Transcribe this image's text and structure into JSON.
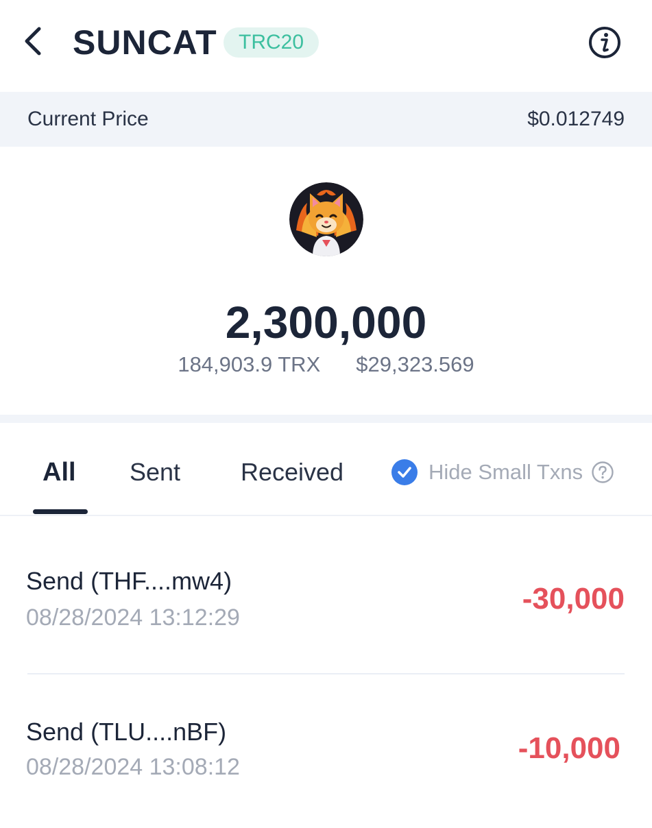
{
  "header": {
    "title": "SUNCAT",
    "badge": "TRC20",
    "back_icon": "chevron-left-icon",
    "info_icon": "info-circle-icon"
  },
  "price": {
    "label": "Current Price",
    "value": "$0.012749"
  },
  "token": {
    "logo_icon": "suncat-cat-logo",
    "balance": "2,300,000",
    "trx_amount": "184,903.9",
    "trx_unit": "TRX",
    "usd_value": "$29,323.569"
  },
  "tabs": [
    {
      "label": "All",
      "active": true
    },
    {
      "label": "Sent",
      "active": false
    },
    {
      "label": "Received",
      "active": false
    }
  ],
  "filter": {
    "hide_small_label": "Hide Small Txns",
    "checked": true,
    "help_icon": "question-circle-icon"
  },
  "transactions": [
    {
      "title": "Send (THF....mw4)",
      "date": "08/28/2024 13:12:29",
      "amount": "-30,000"
    },
    {
      "title": "Send (TLU....nBF)",
      "date": "08/28/2024 13:08:12",
      "amount": "-10,000"
    }
  ],
  "colors": {
    "text_primary": "#1c2538",
    "accent_green": "#3cbf9f",
    "badge_bg": "#e3f4f0",
    "negative": "#e5515b",
    "checkbox_blue": "#3a7de8",
    "muted": "#a4aab6",
    "section_bg": "#f1f4f9"
  }
}
